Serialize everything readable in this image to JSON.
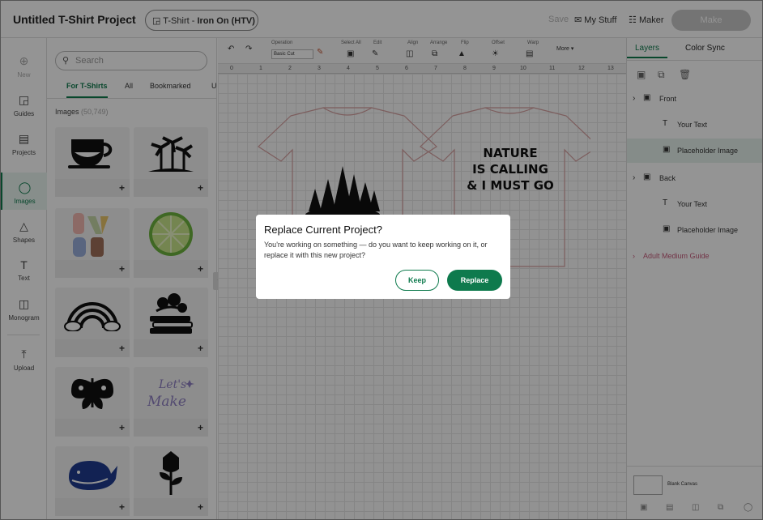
{
  "header": {
    "title": "Untitled T-Shirt Project",
    "project_type_prefix": "T-Shirt - ",
    "project_type_bold": "Iron On (HTV)",
    "save_label": "Save",
    "my_stuff_label": "My Stuff",
    "maker_label": "Maker",
    "make_label": "Make"
  },
  "nav": {
    "items": [
      {
        "label": "New",
        "icon": "plus-circle-icon"
      },
      {
        "label": "Guides",
        "icon": "shirt-icon"
      },
      {
        "label": "Projects",
        "icon": "clipboard-icon"
      },
      {
        "label": "Images",
        "icon": "bulb-icon"
      },
      {
        "label": "Shapes",
        "icon": "shapes-icon"
      },
      {
        "label": "Text",
        "icon": "text-icon"
      },
      {
        "label": "Monogram",
        "icon": "monogram-icon"
      },
      {
        "label": "Upload",
        "icon": "upload-icon"
      }
    ]
  },
  "panel": {
    "search_placeholder": "Search",
    "tabs": [
      "For T-Shirts",
      "All",
      "Bookmarked",
      "U"
    ],
    "images_label": "Images",
    "images_count": "(50,749)"
  },
  "toolbar": {
    "operation_label": "Operation",
    "operation_value": "Basic Cut",
    "select_all_label": "Select All",
    "edit_label": "Edit",
    "align_label": "Align",
    "arrange_label": "Arrange",
    "flip_label": "Flip",
    "offset_label": "Offset",
    "warp_label": "Warp",
    "more_label": "More"
  },
  "ruler": {
    "ticks": [
      "0",
      "1",
      "2",
      "3",
      "4",
      "5",
      "6",
      "7",
      "8",
      "9",
      "10",
      "11",
      "12",
      "13"
    ]
  },
  "canvas": {
    "design_text_lines": [
      "NATURE",
      "IS CALLING",
      "& I MUST GO"
    ]
  },
  "layers": {
    "tabs": [
      "Layers",
      "Color Sync"
    ],
    "rows": [
      {
        "label": "Front",
        "kind": "group"
      },
      {
        "label": "Your Text",
        "kind": "text"
      },
      {
        "label": "Placeholder Image",
        "kind": "image"
      },
      {
        "label": "Back",
        "kind": "group"
      },
      {
        "label": "Your Text",
        "kind": "text"
      },
      {
        "label": "Placeholder Image",
        "kind": "image"
      }
    ],
    "guide_label": "Adult Medium Guide",
    "blank_canvas_label": "Blank Canvas"
  },
  "dialog": {
    "title": "Replace Current Project?",
    "message": "You're working on something — do you want to keep working on it, or replace it with this new project?",
    "keep_label": "Keep",
    "replace_label": "Replace"
  },
  "colors": {
    "accent": "#0e7a4d",
    "guide": "#c55a7a"
  }
}
